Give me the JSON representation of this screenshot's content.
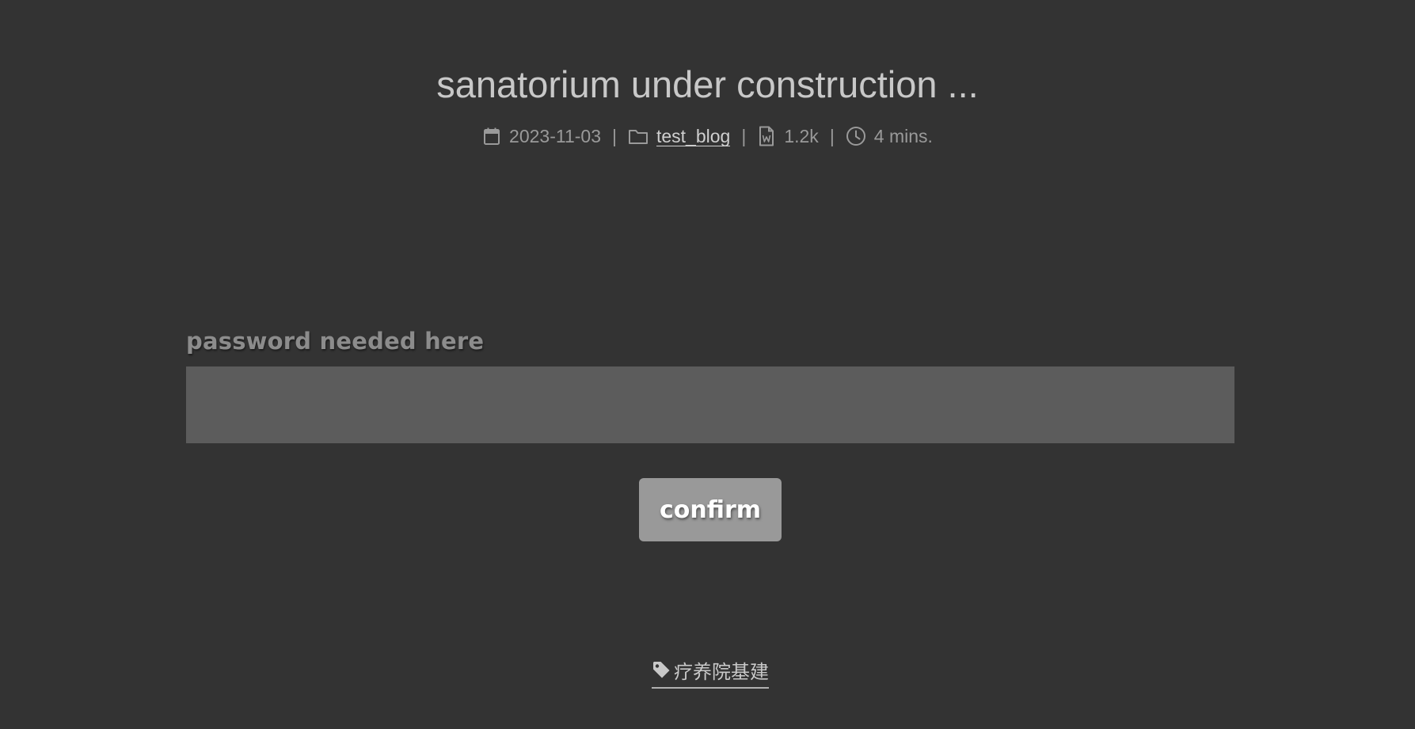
{
  "post": {
    "title": "sanatorium under construction ...",
    "meta": {
      "date": "2023-11-03",
      "date_icon": "calendar-icon",
      "category": "test_blog",
      "category_icon": "folder-icon",
      "word_count": "1.2k",
      "word_count_icon": "word-file-icon",
      "reading_time": "4 mins.",
      "reading_time_icon": "clock-icon",
      "separator": "|"
    }
  },
  "password_form": {
    "label": "password needed here",
    "input_value": "",
    "confirm_label": "confirm"
  },
  "tags": [
    {
      "label": "疗养院基建",
      "icon": "tag-icon"
    }
  ],
  "colors": {
    "background": "#333333",
    "title": "#c8c8c8",
    "meta_text": "#9a9a9a",
    "input_bg": "#5c5c5c",
    "button_bg": "#999999",
    "button_text": "#ffffff"
  }
}
